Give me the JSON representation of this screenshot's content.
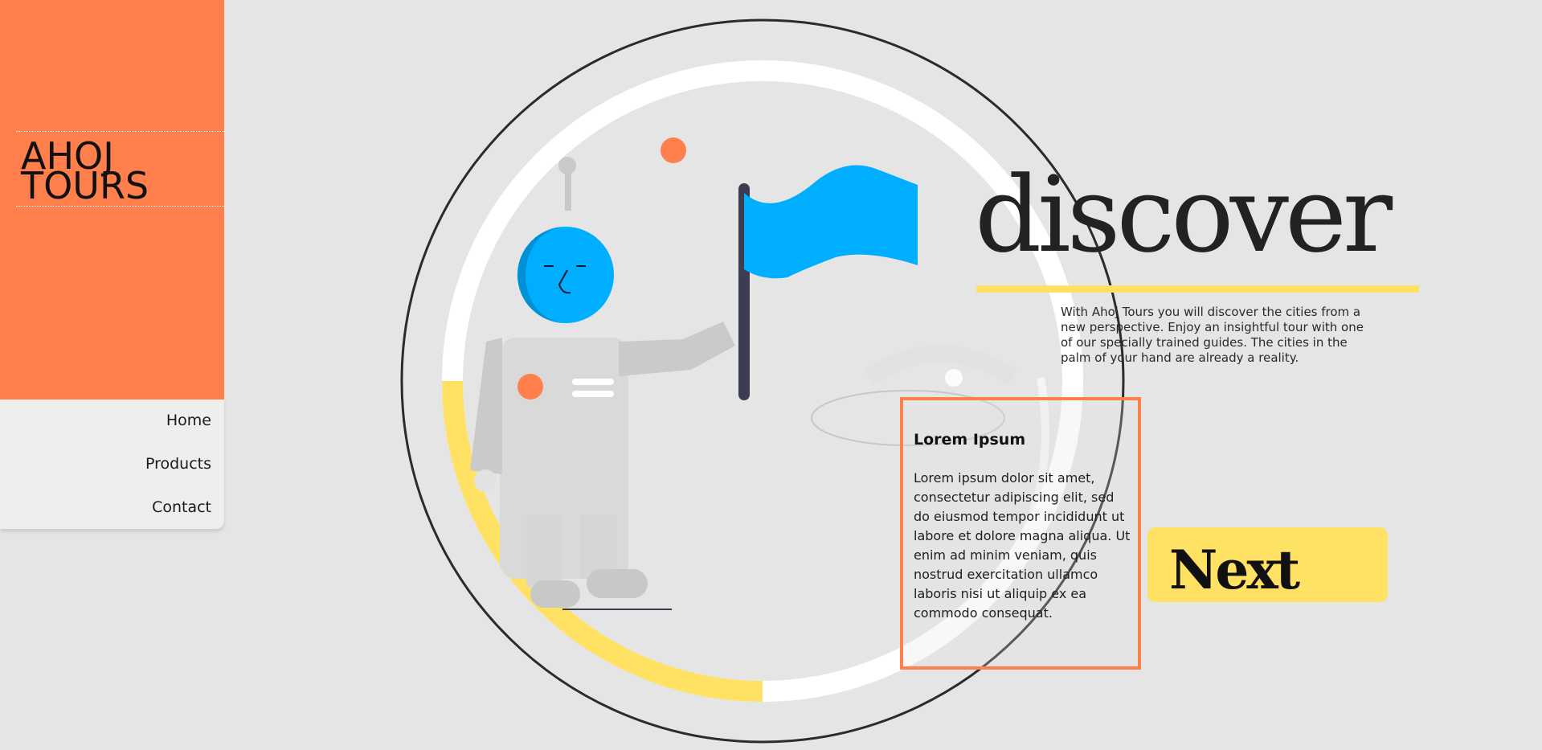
{
  "brand": {
    "line1": "AHOJ",
    "line2": "TOURS"
  },
  "nav": {
    "items": [
      {
        "label": "Home"
      },
      {
        "label": "Products"
      },
      {
        "label": "Contact"
      }
    ]
  },
  "hero": {
    "headline": "discover",
    "intro": "With Ahoj Tours you will discover the cities from a new perspective. Enjoy an insightful tour with one of our specially trained guides. The cities in the palm of your hand are already a reality."
  },
  "card": {
    "title": "Lorem Ipsum",
    "body": "Lorem ipsum dolor sit amet, consectetur adipiscing elit, sed do eiusmod tempor incididunt ut labore et dolore magna aliqua. Ut enim ad minim veniam, quis nostrud exercitation ullamco laboris nisi ut aliquip ex ea commodo consequat."
  },
  "next_button": {
    "label": "Next"
  },
  "colors": {
    "accent_orange": "#ff7f4d",
    "accent_yellow": "#ffe164",
    "flag_blue": "#00aeff",
    "background": "#e5e5e5"
  },
  "icons": [
    "astronaut-illustration",
    "flag-icon",
    "magnifier-lens"
  ]
}
